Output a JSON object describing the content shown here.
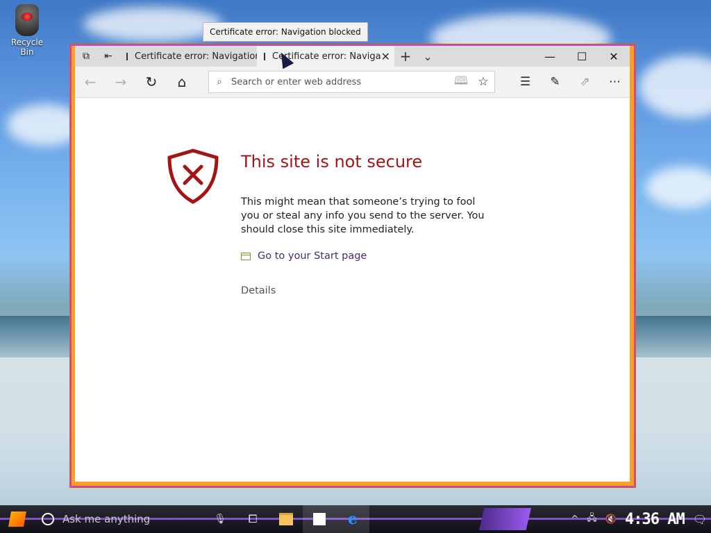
{
  "desktop": {
    "recycle_bin_label": "Recycle Bin"
  },
  "tooltip": "Certificate error: Navigation blocked",
  "browser": {
    "tabs": [
      {
        "label": "Certificate error: Navigation",
        "active": false
      },
      {
        "label": "Certificate error: Naviga",
        "active": true
      }
    ],
    "address_placeholder": "Search or enter web address",
    "address_value": ""
  },
  "error_page": {
    "heading": "This site is not secure",
    "description": "This might mean that someone’s trying to fool you or steal any info you send to the server. You should close this site immediately.",
    "start_link": "Go to your Start page",
    "details": "Details"
  },
  "taskbar": {
    "search_placeholder": "Ask me anything",
    "clock": "4:36 AM"
  },
  "colors": {
    "window_border": "#f7a021",
    "error_red": "#a31515",
    "link": "#4a2a6a",
    "taskbar_accent": "#8e55d6"
  }
}
